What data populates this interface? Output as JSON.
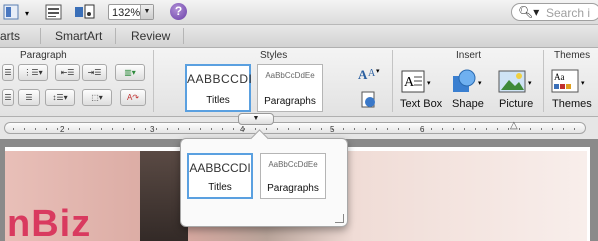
{
  "toolbar": {
    "zoom_value": "132%",
    "search_placeholder": "Search i"
  },
  "tabs": [
    "arts",
    "SmartArt",
    "Review"
  ],
  "ribbon": {
    "groups": {
      "paragraph": "Paragraph",
      "styles": "Styles",
      "insert": "Insert",
      "themes": "Themes"
    },
    "styles": {
      "titles_preview": "AABBCCDI",
      "titles_label": "Titles",
      "paragraphs_preview": "AaBbCcDdEe",
      "paragraphs_label": "Paragraphs"
    },
    "insert": {
      "textbox_label": "Text Box",
      "shape_label": "Shape",
      "picture_label": "Picture"
    },
    "themes_label": "Themes"
  },
  "ruler": {
    "numbers": [
      "2",
      "3",
      "4",
      "5",
      "6"
    ]
  },
  "document": {
    "visible_text": "nBiz"
  },
  "popover": {
    "titles_preview": "AABBCCDI",
    "titles_label": "Titles",
    "paragraphs_preview": "AaBbCcDdEe",
    "paragraphs_label": "Paragraphs"
  },
  "colors": {
    "accent_blue": "#5aa0e0",
    "help_purple": "#6a3fa8",
    "doc_text_pink": "#d93a5f"
  }
}
